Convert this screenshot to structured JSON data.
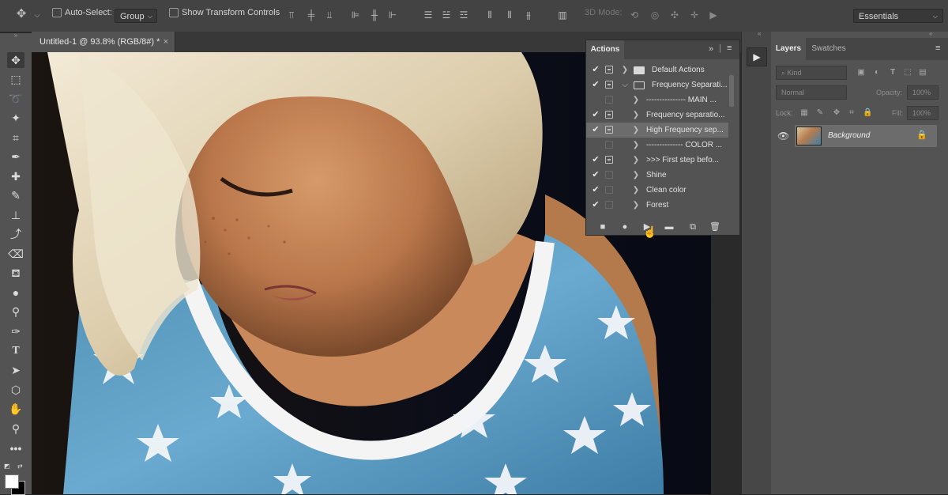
{
  "options_bar": {
    "auto_select_label": "Auto-Select:",
    "group_value": "Group",
    "show_transform_label": "Show Transform Controls",
    "mode_3d_label": "3D Mode:",
    "workspace_value": "Essentials"
  },
  "document": {
    "tab_title": "Untitled-1 @ 93.8% (RGB/8#) *",
    "tab_close": "×"
  },
  "actions_panel": {
    "title": "Actions",
    "rows": [
      {
        "label": "Default Actions",
        "check": "✔",
        "dialog": true,
        "toggle": "❯",
        "type": "set-closed"
      },
      {
        "label": "Frequency Separati...",
        "check": "✔",
        "dialog": true,
        "toggle": "⌵",
        "type": "set-open"
      },
      {
        "label": "--------------- MAIN ...",
        "check": "",
        "dialog": false,
        "toggle": "❯",
        "type": "action"
      },
      {
        "label": "Frequency separatio...",
        "check": "✔",
        "dialog": true,
        "toggle": "❯",
        "type": "action"
      },
      {
        "label": "High Frequency sep...",
        "check": "✔",
        "dialog": true,
        "toggle": "❯",
        "type": "action",
        "selected": true
      },
      {
        "label": "-------------- COLOR ...",
        "check": "",
        "dialog": false,
        "toggle": "❯",
        "type": "action"
      },
      {
        "label": ">>> First step befo...",
        "check": "✔",
        "dialog": true,
        "toggle": "❯",
        "type": "action"
      },
      {
        "label": "Shine",
        "check": "✔",
        "dialog": false,
        "toggle": "❯",
        "type": "action"
      },
      {
        "label": "Clean color",
        "check": "✔",
        "dialog": false,
        "toggle": "❯",
        "type": "action"
      },
      {
        "label": "Forest",
        "check": "✔",
        "dialog": false,
        "toggle": "❯",
        "type": "action"
      }
    ],
    "footer_icons": [
      "stop-icon",
      "record-icon",
      "play-icon",
      "new-set-icon",
      "new-action-icon",
      "trash-icon"
    ]
  },
  "layers_panel": {
    "tab_layers": "Layers",
    "tab_swatches": "Swatches",
    "kind_placeholder": "Kind",
    "blend_mode": "Normal",
    "opacity_label": "Opacity:",
    "opacity_value": "100%",
    "lock_label": "Lock:",
    "fill_label": "Fill:",
    "fill_value": "100%",
    "layer_name": "Background"
  },
  "colors": {
    "accent_selected_row": "#6c6c6c",
    "panel_bg": "#535353"
  }
}
